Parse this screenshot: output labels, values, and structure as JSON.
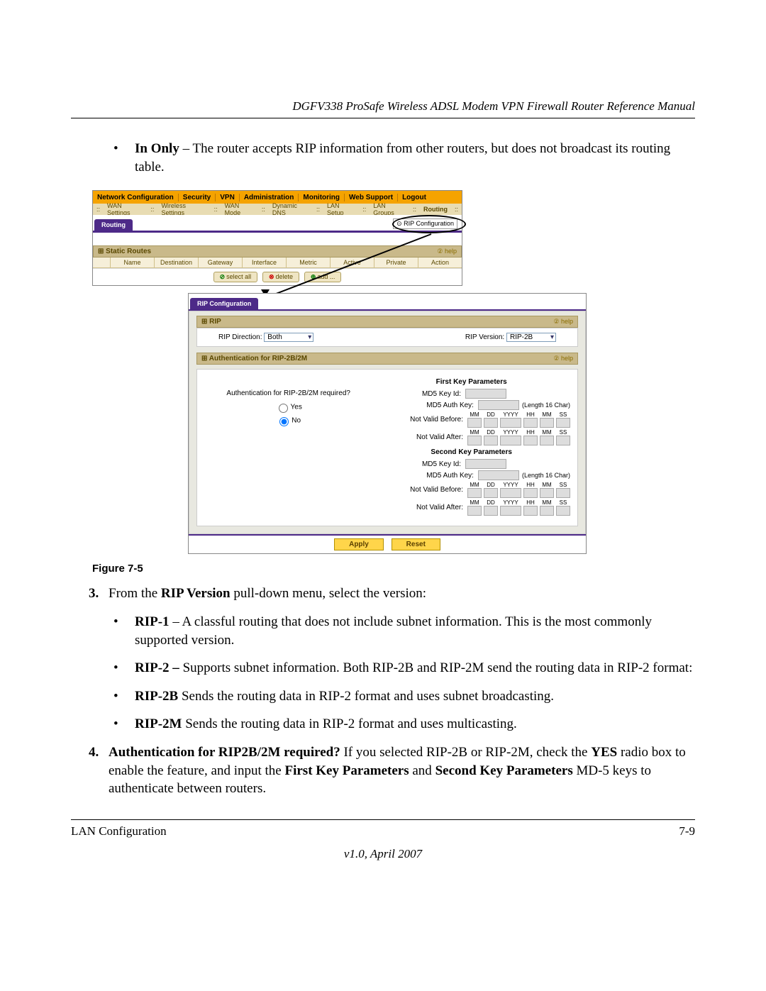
{
  "header": "DGFV338 ProSafe Wireless ADSL Modem VPN Firewall Router Reference Manual",
  "bullet1_prefix": "In Only",
  "bullet1_rest": " – The router accepts RIP information from other routers, but does not broadcast its routing table.",
  "nav": {
    "top": [
      "Network Configuration",
      "Security",
      "VPN",
      "Administration",
      "Monitoring",
      "Web Support",
      "Logout"
    ],
    "sub": [
      "WAN Settings",
      "Wireless Settings",
      "WAN Mode",
      "Dynamic DNS",
      "LAN Setup",
      "LAN Groups",
      "Routing"
    ],
    "routing_tab": "Routing",
    "rip_link": "RIP Configuration"
  },
  "static_routes": {
    "title": "Static Routes",
    "help": "help",
    "cols": [
      "Name",
      "Destination",
      "Gateway",
      "Interface",
      "Metric",
      "Active",
      "Private",
      "Action"
    ],
    "btns": {
      "select": "select all",
      "delete": "delete",
      "add": "add ..."
    }
  },
  "rip_config": {
    "tab": "RIP Configuration",
    "section": "RIP",
    "help": "help",
    "dir_label": "RIP Direction:",
    "dir_value": "Both",
    "ver_label": "RIP Version:",
    "ver_value": "RIP-2B",
    "auth_section": "Authentication for RIP-2B/2M",
    "auth_q": "Authentication for RIP-2B/2M required?",
    "yes": "Yes",
    "no": "No",
    "first": "First Key Parameters",
    "second": "Second Key Parameters",
    "md5id": "MD5 Key Id:",
    "md5auth": "MD5 Auth Key:",
    "notbefore": "Not Valid Before:",
    "notafter": "Not Valid After:",
    "len": "(Length 16 Char)",
    "date_labels": [
      "MM",
      "DD",
      "YYYY",
      "HH",
      "MM",
      "SS"
    ],
    "apply": "Apply",
    "reset": "Reset"
  },
  "figure": "Figure 7-5",
  "step3_num": "3.",
  "step3_a": "From the ",
  "step3_b": "RIP Version",
  "step3_c": " pull-down menu, select the version:",
  "rip1_a": "RIP-1",
  "rip1_b": " – A classful routing that does not include subnet information. This is the most commonly supported version.",
  "rip2_a": "RIP-2 – ",
  "rip2_b": "Supports subnet information. Both RIP-2B and RIP-2M send the routing data in RIP-2 format:",
  "rip2b_a": "RIP-2B",
  "rip2b_b": " Sends the routing data in RIP-2 format and uses subnet broadcasting.",
  "rip2m_a": "RIP-2M",
  "rip2m_b": " Sends the routing data in RIP-2 format and uses multicasting.",
  "step4_num": "4.",
  "step4_a": "Authentication for RIP2B/2M required?",
  "step4_b": " If you selected RIP-2B or RIP-2M, check the ",
  "step4_c": "YES",
  "step4_d": " radio box to enable the feature, and input the ",
  "step4_e": "First Key Parameters",
  "step4_f": " and ",
  "step4_g": "Second Key Parameters",
  "step4_h": " MD-5 keys to authenticate between routers.",
  "footer_left": "LAN Configuration",
  "footer_right": "7-9",
  "version": "v1.0, April 2007"
}
